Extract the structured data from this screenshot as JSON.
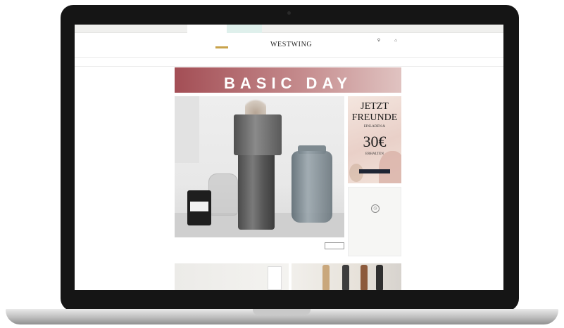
{
  "top_strip": {
    "tab_primary": "",
    "tab_secondary": "",
    "links": ""
  },
  "header": {
    "sub_logo": "",
    "sister_logo": "",
    "brand": "WESTWING",
    "account_label": "",
    "cart_label": ""
  },
  "nav": {
    "items": [
      "",
      "",
      "",
      ""
    ]
  },
  "banner": {
    "subtitle": "",
    "title": "BASIC DAY"
  },
  "hero": {
    "title": "",
    "text": "",
    "date": "",
    "button_label": ""
  },
  "promo": {
    "line1": "JETZT",
    "line2": "FREUNDE",
    "line3": "EINLADEN &",
    "amount": "30€",
    "line4": "ERHALTEN"
  },
  "sales_card": {
    "title": "",
    "subtitle": "",
    "link": ""
  },
  "tiles": {
    "card_text": ""
  },
  "colors": {
    "accent": "#4a8f7e",
    "banner": "#a34e55",
    "gold": "#c8a24a",
    "promo_button": "#1e2433"
  }
}
